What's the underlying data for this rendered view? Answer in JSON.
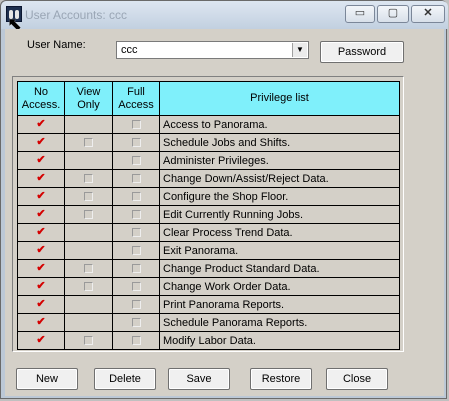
{
  "window": {
    "title": "User Accounts:  ccc",
    "minimize_glyph": "▭",
    "maximize_glyph": "▢",
    "close_glyph": "✕"
  },
  "form": {
    "user_name_label": "User Name:",
    "user_name_value": "ccc",
    "dropdown_arrow": "▼",
    "password_button": "Password"
  },
  "table": {
    "headers": {
      "no_access": "No Access.",
      "view_only": "View Only",
      "full_access": "Full Access",
      "privilege_list": "Privilege list"
    },
    "check_mark": "✔",
    "rows": [
      {
        "privilege": "Access to Panorama.",
        "view_only_box": false
      },
      {
        "privilege": "Schedule Jobs and Shifts.",
        "view_only_box": true
      },
      {
        "privilege": "Administer Privileges.",
        "view_only_box": false
      },
      {
        "privilege": "Change Down/Assist/Reject Data.",
        "view_only_box": true
      },
      {
        "privilege": "Configure the Shop Floor.",
        "view_only_box": true
      },
      {
        "privilege": "Edit Currently Running Jobs.",
        "view_only_box": true
      },
      {
        "privilege": "Clear Process Trend Data.",
        "view_only_box": false
      },
      {
        "privilege": "Exit Panorama.",
        "view_only_box": false
      },
      {
        "privilege": "Change Product Standard Data.",
        "view_only_box": true
      },
      {
        "privilege": "Change Work Order Data.",
        "view_only_box": true
      },
      {
        "privilege": "Print Panorama Reports.",
        "view_only_box": false
      },
      {
        "privilege": "Schedule Panorama Reports.",
        "view_only_box": false
      },
      {
        "privilege": "Modify Labor Data.",
        "view_only_box": true
      }
    ]
  },
  "buttons": {
    "new": "New",
    "delete": "Delete",
    "save": "Save",
    "restore": "Restore",
    "close": "Close"
  },
  "colors": {
    "header_bg": "#7ff0fb",
    "check_red": "#d40000",
    "dialog_bg": "#d4d0c8"
  }
}
